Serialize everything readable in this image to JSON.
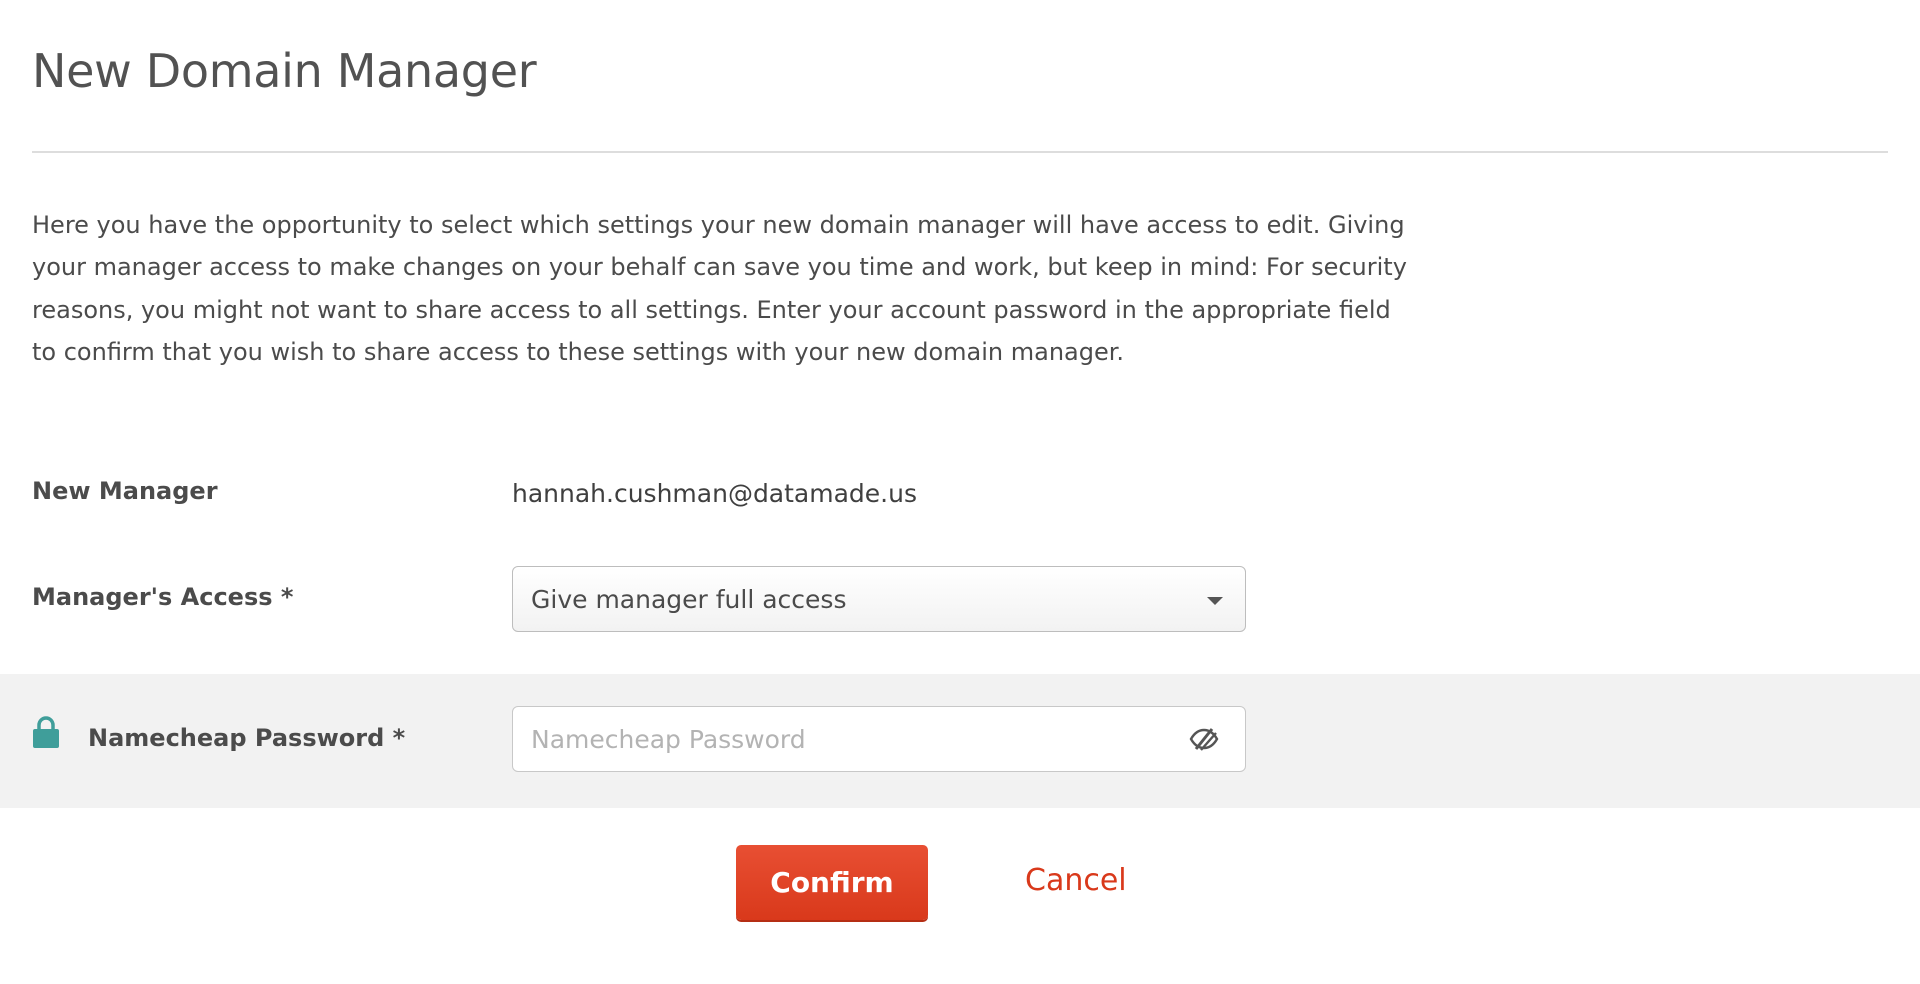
{
  "page": {
    "title": "New Domain Manager",
    "description": "Here you have the opportunity to select which settings your new domain manager will have access to edit. Giving your manager access to make changes on your behalf can save you time and work, but keep in mind: For security reasons, you might not want to share access to all settings. Enter your account password in the appropriate field to confirm that you wish to share access to these settings with your new domain manager."
  },
  "form": {
    "new_manager": {
      "label": "New Manager",
      "value": "hannah.cushman@datamade.us"
    },
    "access": {
      "label": "Manager's Access *",
      "selected": "Give manager full access"
    },
    "password": {
      "label": "Namecheap Password *",
      "placeholder": "Namecheap Password",
      "value": "",
      "lock_icon": "lock-icon",
      "toggle_icon": "eye-slash-icon"
    }
  },
  "actions": {
    "confirm_label": "Confirm",
    "cancel_label": "Cancel"
  },
  "colors": {
    "accent": "#d9391b",
    "lock_icon": "#3f9e9a",
    "band_background": "#f2f2f2"
  }
}
